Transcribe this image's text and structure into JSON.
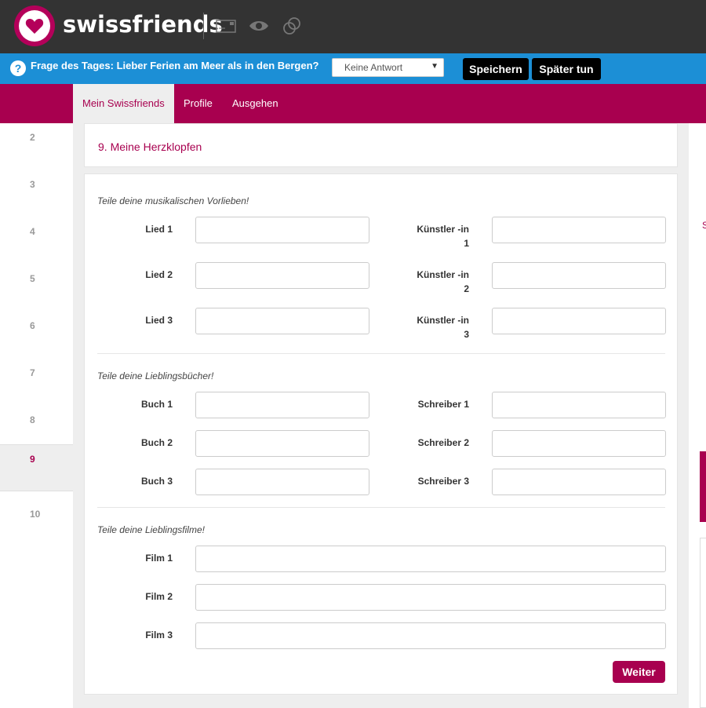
{
  "brand": {
    "name": "swissfriends",
    "color": "#b4005a"
  },
  "topbar": {
    "icons": [
      "mail-icon",
      "eye-icon",
      "rings-icon"
    ]
  },
  "question": {
    "text": "Frage des Tages: Lieber Ferien am Meer als in den Bergen?",
    "select_value": "Keine Antwort",
    "save_label": "Speichern",
    "later_label": "Später tun"
  },
  "nav": {
    "items": [
      {
        "label": "Mein Swissfriends",
        "active": true
      },
      {
        "label": "Profile",
        "active": false
      },
      {
        "label": "Ausgehen",
        "active": false
      }
    ]
  },
  "steps": [
    {
      "label": "2"
    },
    {
      "label": "3"
    },
    {
      "label": "4"
    },
    {
      "label": "5"
    },
    {
      "label": "6"
    },
    {
      "label": "7"
    },
    {
      "label": "8"
    },
    {
      "label": "9"
    },
    {
      "label": "10"
    }
  ],
  "right": {
    "letter": "S"
  },
  "page": {
    "title": "9. Meine Herzklopfen",
    "music": {
      "heading": "Teile deine musikalischen Vorlieben!",
      "songs": [
        "Lied 1",
        "Lied 2",
        "Lied 3"
      ],
      "artists": [
        {
          "line1": "Künstler -in",
          "line2": "1"
        },
        {
          "line1": "Künstler -in",
          "line2": "2"
        },
        {
          "line1": "Künstler -in",
          "line2": "3"
        }
      ]
    },
    "books": {
      "heading": "Teile deine Lieblingsbücher!",
      "books": [
        "Buch 1",
        "Buch 2",
        "Buch 3"
      ],
      "writers": [
        "Schreiber 1",
        "Schreiber 2",
        "Schreiber 3"
      ]
    },
    "films": {
      "heading": "Teile deine Lieblingsfilme!",
      "films": [
        "Film 1",
        "Film 2",
        "Film 3"
      ]
    },
    "next_label": "Weiter"
  }
}
